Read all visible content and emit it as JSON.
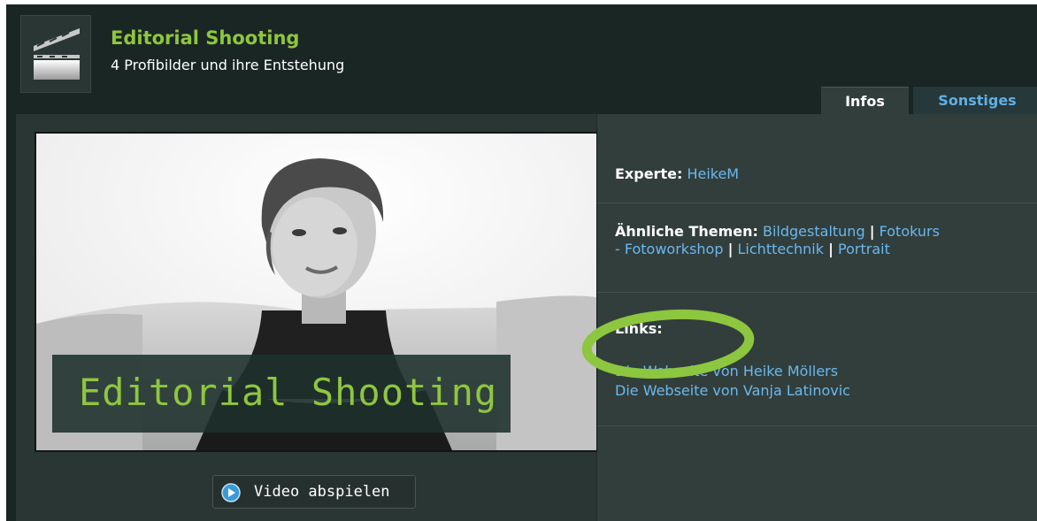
{
  "header": {
    "title": "Editorial Shooting",
    "subtitle": "4 Profibilder und ihre Entstehung",
    "icon": "clapperboard-icon"
  },
  "tabs": [
    {
      "label": "Infos",
      "active": true
    },
    {
      "label": "Sonstiges",
      "active": false
    }
  ],
  "video": {
    "overlay_title": "Editorial Shooting",
    "play_label": "Video abspielen",
    "play_icon": "play-icon"
  },
  "info": {
    "expert_label": "Experte:",
    "expert_name": "HeikeM",
    "topics_label": "Ähnliche Themen:",
    "topics": [
      "Bildgestaltung",
      "Fotokurs",
      "- Fotoworkshop",
      "Lichttechnik",
      "Portrait"
    ],
    "separator": "|",
    "links_label": "Links:",
    "links": [
      "Die Webseite von Heike Möllers",
      "Die Webseite von Vanja Latinovic"
    ]
  },
  "colors": {
    "accent_green": "#8ec63f",
    "link_blue": "#6ab8ee",
    "background": "#1a2624",
    "highlight_circle": "#8dc63f"
  }
}
